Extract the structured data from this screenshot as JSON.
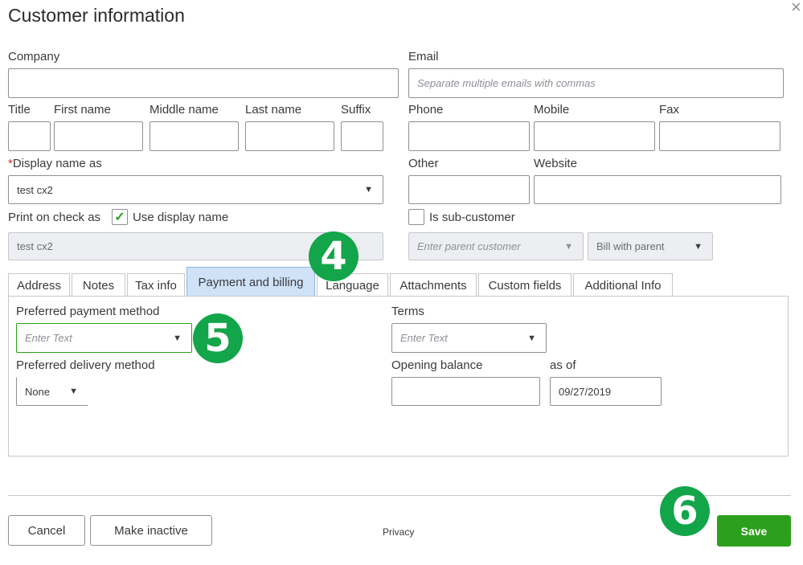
{
  "dialog": {
    "title": "Customer information",
    "close_icon": "×"
  },
  "fields": {
    "company_label": "Company",
    "email_label": "Email",
    "email_placeholder": "Separate multiple emails with commas",
    "title_label": "Title",
    "first_name_label": "First name",
    "middle_name_label": "Middle name",
    "last_name_label": "Last name",
    "suffix_label": "Suffix",
    "phone_label": "Phone",
    "mobile_label": "Mobile",
    "fax_label": "Fax",
    "display_name_required": "*",
    "display_name_label": "Display name as",
    "display_name_value": "test cx2",
    "other_label": "Other",
    "website_label": "Website",
    "print_on_check_label": "Print on check as",
    "use_display_name_label": "Use display name",
    "use_display_name_checked": true,
    "print_on_check_value": "test cx2",
    "is_sub_customer_label": "Is sub-customer",
    "parent_customer_placeholder": "Enter parent customer",
    "bill_with_parent_value": "Bill with parent"
  },
  "tabs": [
    {
      "label": "Address",
      "active": false
    },
    {
      "label": "Notes",
      "active": false
    },
    {
      "label": "Tax info",
      "active": false
    },
    {
      "label": "Payment and billing",
      "active": true
    },
    {
      "label": "Language",
      "active": false
    },
    {
      "label": "Attachments",
      "active": false
    },
    {
      "label": "Custom fields",
      "active": false
    },
    {
      "label": "Additional Info",
      "active": false
    }
  ],
  "payment": {
    "preferred_payment_label": "Preferred payment method",
    "preferred_payment_placeholder": "Enter Text",
    "terms_label": "Terms",
    "terms_placeholder": "Enter Text",
    "preferred_delivery_label": "Preferred delivery method",
    "preferred_delivery_value": "None",
    "opening_balance_label": "Opening balance",
    "opening_balance_value": "",
    "as_of_label": "as of",
    "as_of_value": "09/27/2019"
  },
  "footer": {
    "cancel_label": "Cancel",
    "make_inactive_label": "Make inactive",
    "privacy_label": "Privacy",
    "save_label": "Save"
  },
  "annotations": {
    "step4": "4",
    "step5": "5",
    "step6": "6"
  },
  "colors": {
    "accent_green": "#2ca01c",
    "badge_green": "#13a54a",
    "active_tab": "#cfe2f7"
  }
}
